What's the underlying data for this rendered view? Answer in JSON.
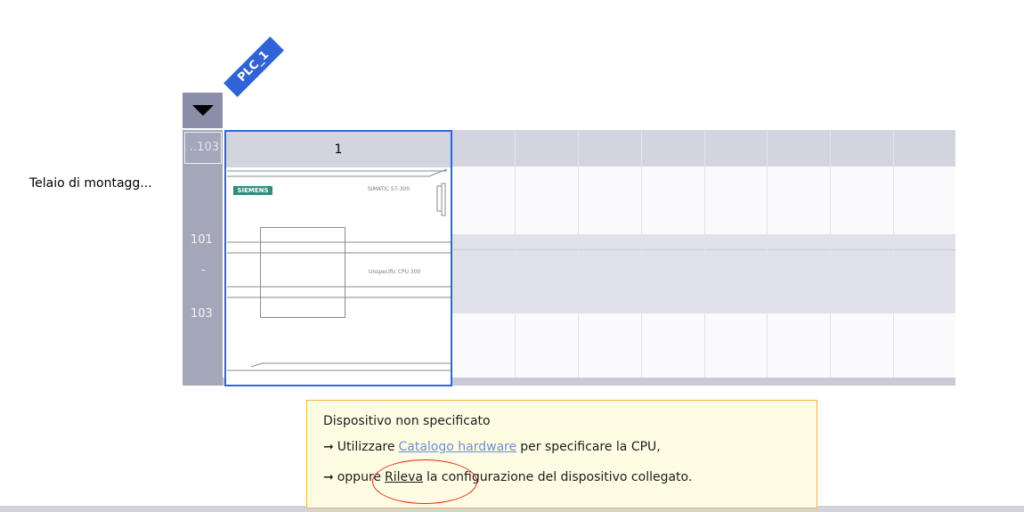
{
  "device": {
    "tag": "PLC_1"
  },
  "rack": {
    "label": "Telaio di montagg...",
    "slot_range_top": "..103",
    "side_numbers": [
      "101",
      "-",
      "103"
    ],
    "selected_slot": {
      "number": "1"
    },
    "module": {
      "brand": "SIEMENS",
      "model": "SIMATIC S7-300",
      "cpu_text": "Unspecific CPU 300"
    }
  },
  "tooltip": {
    "title": "Dispositivo non specificato",
    "line1": {
      "prefix": "Utilizzare",
      "link": "Catalogo hardware",
      "suffix": "per specificare la CPU,"
    },
    "line2": {
      "prefix": "oppure",
      "link": "Rileva",
      "suffix": "la configurazione del dispositivo collegato."
    }
  },
  "colors": {
    "accent": "#2f66df",
    "tooltip_bg": "#fffce4",
    "tooltip_border": "#f0b347",
    "highlight": "#e0281e"
  }
}
